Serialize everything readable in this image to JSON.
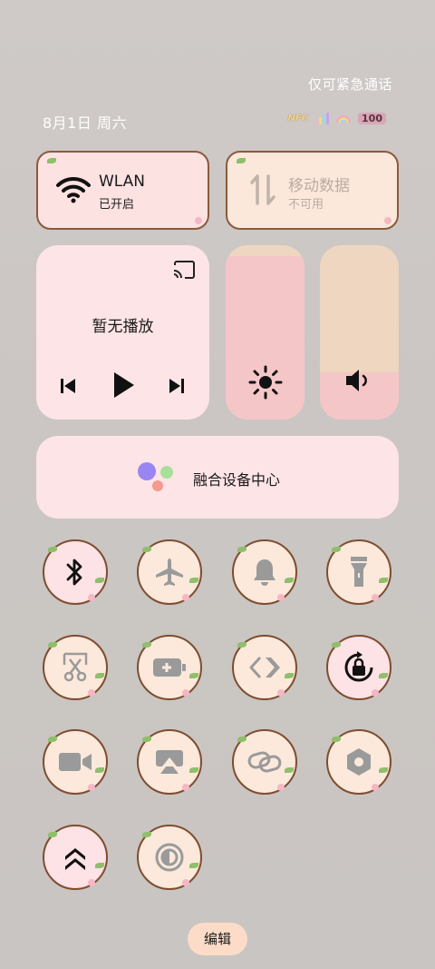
{
  "status_bar": {
    "emergency_text": "仅可紧急通话",
    "date_text": "8月1日 周六",
    "nfc_label": "NFC",
    "battery_level": "100"
  },
  "tiles": {
    "wlan": {
      "title": "WLAN",
      "subtitle": "已开启"
    },
    "mobile_data": {
      "title": "移动数据",
      "subtitle": "不可用"
    }
  },
  "media": {
    "title": "暂无播放"
  },
  "sliders": {
    "brightness_level": 0.94,
    "volume_level": 0.27
  },
  "hub": {
    "label": "融合设备中心"
  },
  "toggles": [
    {
      "name": "bluetooth",
      "icon": "bluetooth-icon",
      "active": true
    },
    {
      "name": "airplane-mode",
      "icon": "airplane-icon",
      "active": false
    },
    {
      "name": "sound",
      "icon": "bell-icon",
      "active": false
    },
    {
      "name": "flashlight",
      "icon": "flashlight-icon",
      "active": false
    },
    {
      "name": "screenshot",
      "icon": "scissors-icon",
      "active": false
    },
    {
      "name": "battery-saver",
      "icon": "battery-plus-icon",
      "active": false
    },
    {
      "name": "remote-share",
      "icon": "share-arrows-icon",
      "active": false
    },
    {
      "name": "auto-rotate-lock",
      "icon": "rotation-lock-icon",
      "active": true
    },
    {
      "name": "screen-record",
      "icon": "video-camera-icon",
      "active": false
    },
    {
      "name": "screen-cast",
      "icon": "cast-icon",
      "active": false
    },
    {
      "name": "link-share",
      "icon": "link-icon",
      "active": false
    },
    {
      "name": "settings-hexagon",
      "icon": "hexagon-icon",
      "active": false
    },
    {
      "name": "double-chevron",
      "icon": "double-chevron-up-icon",
      "active": true
    },
    {
      "name": "dark-mode",
      "icon": "contrast-icon",
      "active": false
    }
  ],
  "edit_button": {
    "label": "编辑"
  },
  "colors": {
    "tile_pink": "#fde2e2",
    "tile_peach": "#fce8da",
    "border_brown": "#8b5a3c",
    "slider_pink": "#f5c6c8",
    "slider_peach": "#efd6c0"
  }
}
